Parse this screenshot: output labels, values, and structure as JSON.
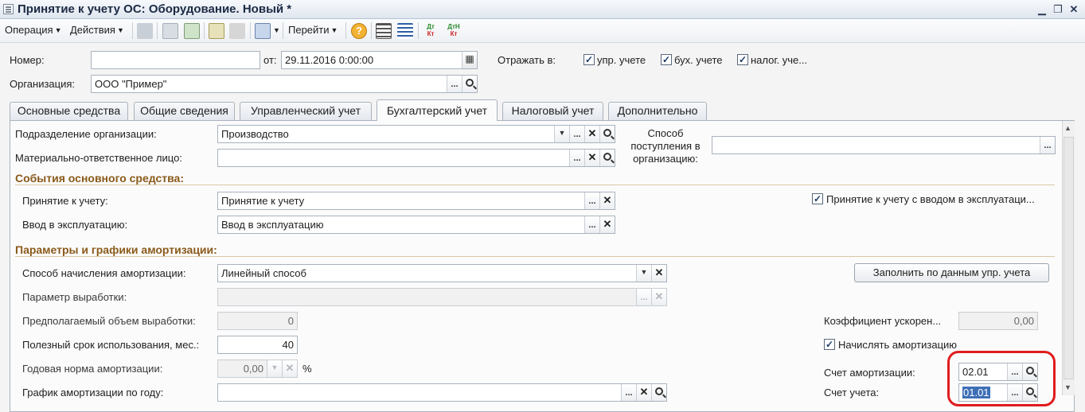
{
  "window": {
    "title": "Принятие к учету ОС: Оборудование. Новый *"
  },
  "toolbar": {
    "operation_label": "Операция",
    "actions_label": "Действия",
    "goto_label": "Перейти"
  },
  "header": {
    "number_label": "Номер:",
    "number_value": "",
    "date_label": "от:",
    "date_value": "29.11.2016  0:00:00",
    "reflect_label": "Отражать в:",
    "reflect": [
      {
        "label": "упр. учете",
        "checked": true
      },
      {
        "label": "бух. учете",
        "checked": true
      },
      {
        "label": "налог. уче...",
        "checked": true
      }
    ],
    "organization_label": "Организация:",
    "organization_value": "ООО \"Пример\""
  },
  "tabs": [
    {
      "label": "Основные средства"
    },
    {
      "label": "Общие сведения"
    },
    {
      "label": "Управленческий учет"
    },
    {
      "label": "Бухгалтерский учет",
      "active": true
    },
    {
      "label": "Налоговый учет"
    },
    {
      "label": "Дополнительно"
    }
  ],
  "accounting": {
    "division_label": "Подразделение организации:",
    "division_value": "Производство",
    "responsible_label": "Материально-ответственное лицо:",
    "responsible_value": "",
    "receipt_method_label": "Способ поступления в организацию:",
    "receipt_method_value": "",
    "events_group": "События основного средства:",
    "acceptance_label": "Принятие к учету:",
    "acceptance_value": "Принятие к учету",
    "commissioning_label": "Ввод в эксплуатацию:",
    "commissioning_value": "Ввод в эксплуатацию",
    "acceptance_with_commissioning_label": "Принятие к учету с вводом в эксплуатаци...",
    "acceptance_with_commissioning_checked": true,
    "depreciation_group": "Параметры и графики амортизации:",
    "method_label": "Способ начисления амортизации:",
    "method_value": "Линейный способ",
    "fill_button": "Заполнить по данным упр. учета",
    "output_param_label": "Параметр выработки:",
    "output_param_value": "",
    "expected_volume_label": "Предполагаемый объем выработки:",
    "expected_volume_value": "0",
    "acceleration_label": "Коэффициент ускорен...",
    "acceleration_value": "0,00",
    "useful_life_label": "Полезный срок использования, мес.:",
    "useful_life_value": "40",
    "accrue_label": "Начислять амортизацию",
    "accrue_checked": true,
    "annual_rate_label": "Годовая норма амортизации:",
    "annual_rate_value": "0,00",
    "annual_rate_unit": "%",
    "depr_account_label": "Счет амортизации:",
    "depr_account_value": "02.01",
    "schedule_label": "График амортизации по году:",
    "schedule_value": "",
    "account_label": "Счет учета:",
    "account_value": "01.01"
  },
  "colors": {
    "group_header": "#8a5a1a",
    "highlight_ring": "#e01c1c",
    "selection": "#3e6fb6"
  }
}
